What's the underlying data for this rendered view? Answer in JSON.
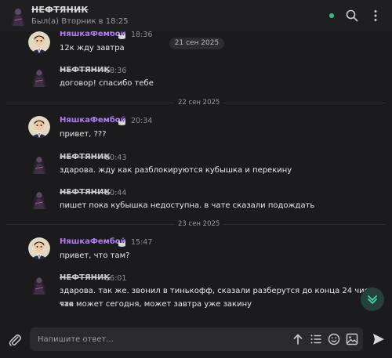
{
  "header": {
    "name": "НЕФТЯНИК",
    "status": "Был(а) Вторник в 18:25"
  },
  "messages": [
    {
      "sender": "НяшкаФембой",
      "time": "18:36",
      "text": "12к жду завтра"
    },
    {
      "sender": "НЕФТЯНИК",
      "time": "18:36",
      "text": "договор! спасибо тебе"
    },
    {
      "sender": "НяшкаФембой",
      "time": "20:34",
      "text": "привет, ???"
    },
    {
      "sender": "НЕФТЯНИК",
      "time": "20:43",
      "text": "здарова. жду как разблокируются кубышка и перекину"
    },
    {
      "sender": "НЕФТЯНИК",
      "time": "20:44",
      "text": "пишет пока кубышка недоступна. в чате сказали подождать"
    },
    {
      "sender": "НяшкаФембой",
      "time": "15:47",
      "text": "привет, что там?"
    },
    {
      "sender": "НЕФТЯНИК",
      "time": "16:01",
      "text_line1": "здарова. так же. звонил в тинькофф, сказали разберутся до конца 24 числа. так",
      "text_line2": "что может сегодня, может завтра уже закину"
    }
  ],
  "dates": {
    "floating": "21 сен 2025",
    "sep1": "22 сен 2025",
    "sep2": "23 сен 2025"
  },
  "composer": {
    "placeholder": "Напишите ответ..."
  },
  "colors": {
    "accent_purple": "#b07cf0",
    "online_green": "#33c08a",
    "scroll_btn_arrow": "#3fd3a5"
  }
}
